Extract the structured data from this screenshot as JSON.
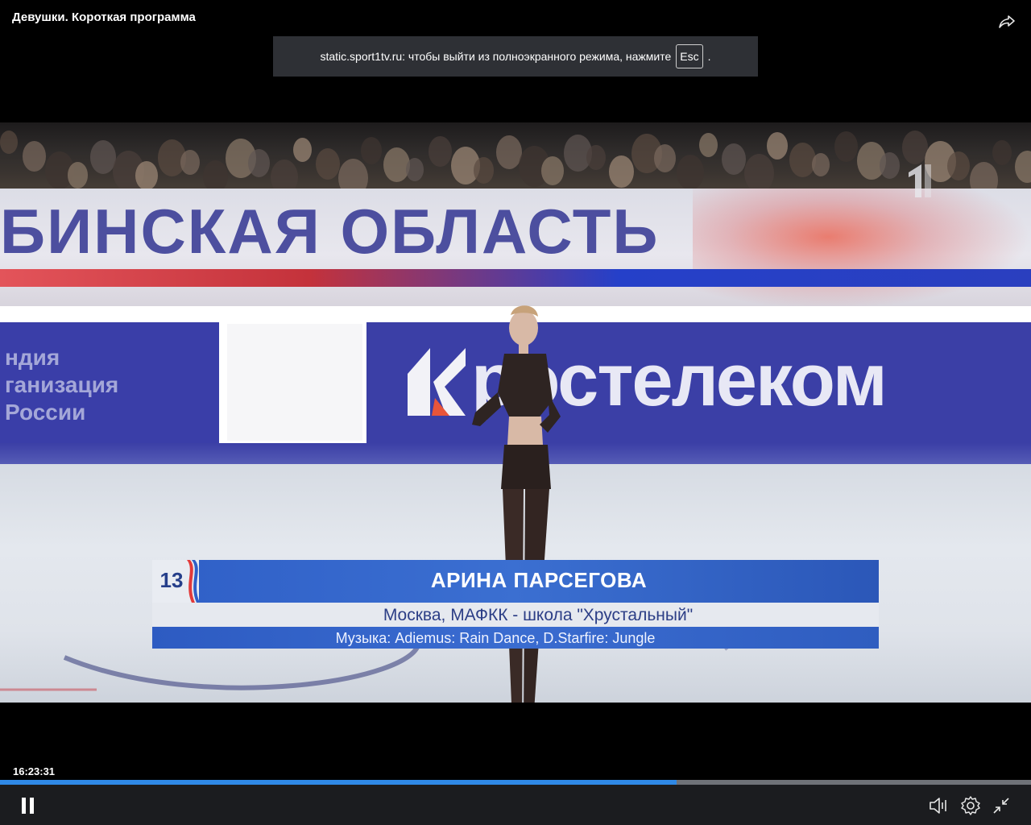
{
  "header": {
    "title": "Девушки. Короткая программа",
    "share_icon": "share-icon"
  },
  "fullscreen_notice": {
    "text": "static.sport1tv.ru: чтобы выйти из полноэкранного режима, нажмите",
    "key": "Esc",
    "suffix": "."
  },
  "video": {
    "banner_text": "БИНСКАЯ ОБЛАСТЬ",
    "board_left_text": [
      "ндия",
      "ганизация",
      "России"
    ],
    "board_brand": "ростелеком",
    "lower_third": {
      "number": "13",
      "name": "АРИНА ПАРСЕГОВА",
      "club": "Москва, МАФКК - школа \"Хрустальный\"",
      "music": "Музыка: Adiemus: Rain Dance, D.Starfire: Jungle"
    }
  },
  "controls": {
    "timecode": "16:23:31",
    "progress_fraction": 0.656,
    "buttons": [
      "pause-icon",
      "volume-icon",
      "settings-icon",
      "exit-fullscreen-icon"
    ]
  },
  "colors": {
    "progress": "#2f89e6",
    "lower_third_blue": "#3b6fd1",
    "notice_bg": "#2e3035"
  }
}
